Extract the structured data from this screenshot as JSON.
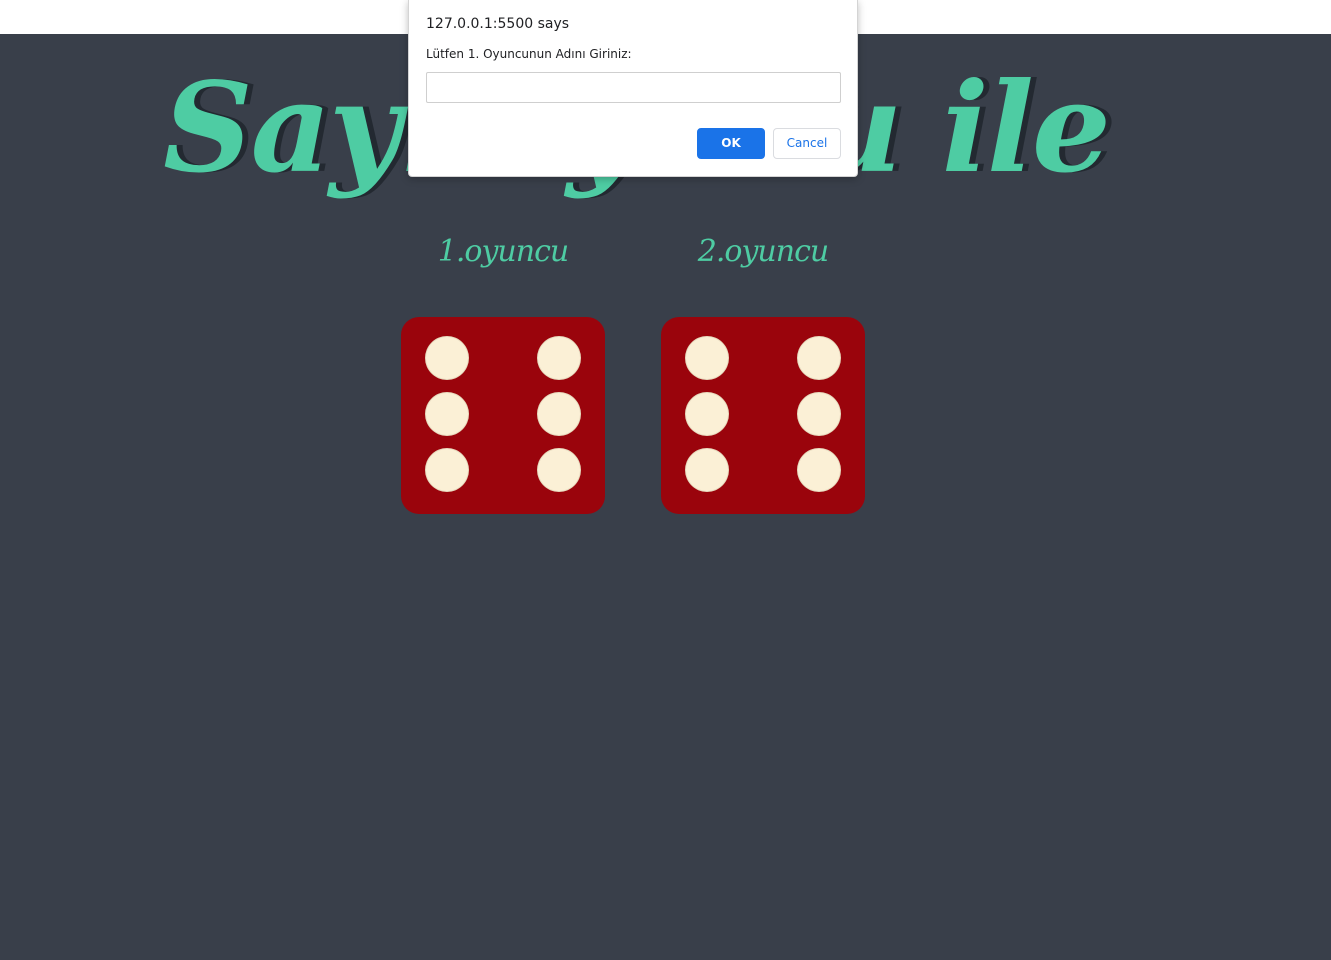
{
  "page": {
    "title_text": "Sayı oyunu ile",
    "players": [
      {
        "label": "1.oyuncu",
        "die_value": 6
      },
      {
        "label": "2.oyuncu",
        "die_value": 6
      }
    ]
  },
  "dialog": {
    "origin": "127.0.0.1:5500 says",
    "message": "Lütfen 1. Oyuncunun Adını Giriniz:",
    "input_value": "",
    "ok_label": "OK",
    "cancel_label": "Cancel"
  },
  "colors": {
    "background": "#393f4a",
    "accent": "#4ecca3",
    "die": "#9a040c",
    "pip": "#fbf0d6",
    "button_primary": "#1a73e8"
  }
}
